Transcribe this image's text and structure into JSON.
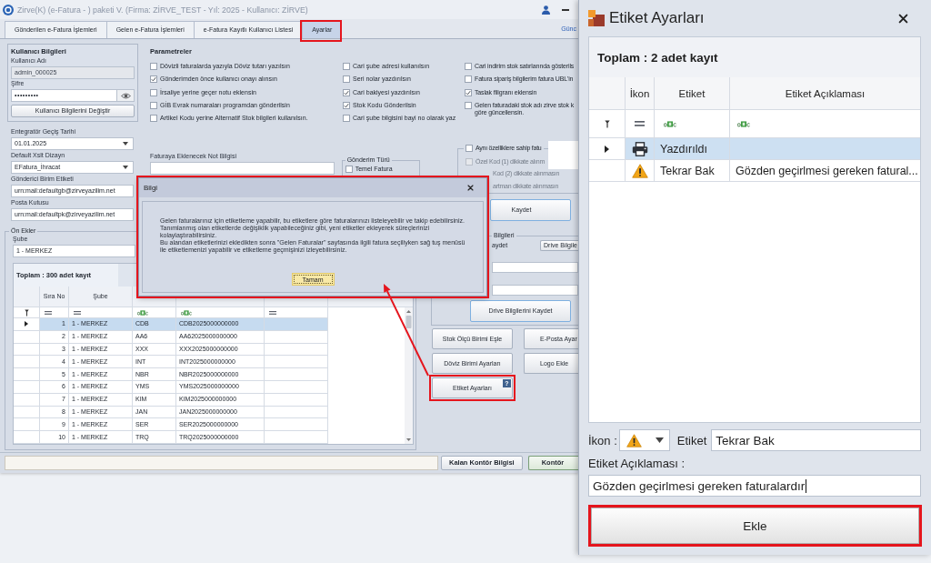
{
  "main_window": {
    "title": "Zirve(K) (e-Fatura - ) paketi V. (Firma: ZİRVE_TEST - Yıl: 2025 - Kullanıcı: ZİRVE)",
    "tabs": [
      {
        "label": "Gönderilen e-Fatura İşlemleri",
        "selected": false,
        "highlighted": false
      },
      {
        "label": "Gelen e-Fatura İşlemleri",
        "selected": false,
        "highlighted": false
      },
      {
        "label": "e-Fatura Kayıtlı Kullanıcı Listesi",
        "selected": false,
        "highlighted": false
      },
      {
        "label": "Ayarlar",
        "selected": true,
        "highlighted": true
      }
    ],
    "update_link": "Günc",
    "user_info": {
      "title": "Kullanıcı Bilgileri",
      "username_label": "Kullanıcı Adı",
      "username": "admin_000025",
      "username_disabled": true,
      "password_label": "Şifre",
      "password": "•••••••••",
      "change_button": "Kullanıcı Bilgilerini Değiştir"
    },
    "settings_fields": [
      {
        "label": "Entegratör Geçiş Tarihi",
        "value": "01.01.2025",
        "kind": "dropdown"
      },
      {
        "label": "Default Xslt Dizayn",
        "value": "EFatura_İhracat",
        "kind": "dropdown"
      },
      {
        "label": "Gönderici Birim Etiketi",
        "value": "urn:mail:defaultgb@zirveyazilim.net",
        "kind": "text"
      },
      {
        "label": "Posta Kutusu",
        "value": "urn:mail:defaultpk@zirveyazilim.net",
        "kind": "text"
      }
    ],
    "prefixes": {
      "title": "Ön Ekler",
      "branch_label": "Şube",
      "branch_value": "1 - MERKEZ",
      "table": {
        "total": "Toplam : 300 adet kayıt",
        "columns": [
          {
            "label": "Sıra No",
            "kind": "equals"
          },
          {
            "label": "Şube",
            "kind": "equals"
          },
          {
            "kind": "text"
          },
          {
            "kind": "text"
          },
          {
            "kind": "equals"
          }
        ],
        "rows": [
          {
            "no": "1",
            "branch": "1 - MERKEZ",
            "column_3": "CDB",
            "column_4": "CDB2025000000000",
            "selected": true
          },
          {
            "no": "2",
            "branch": "1 - MERKEZ",
            "column_3": "AA6",
            "column_4": "AA62025000000000",
            "selected": false
          },
          {
            "no": "3",
            "branch": "1 - MERKEZ",
            "column_3": "XXX",
            "column_4": "XXX2025000000000",
            "selected": false
          },
          {
            "no": "4",
            "branch": "1 - MERKEZ",
            "column_3": "INT",
            "column_4": "INT2025000000000",
            "selected": false
          },
          {
            "no": "5",
            "branch": "1 - MERKEZ",
            "column_3": "NBR",
            "column_4": "NBR2025000000000",
            "selected": false
          },
          {
            "no": "6",
            "branch": "1 - MERKEZ",
            "column_3": "YMS",
            "column_4": "YMS2025000000000",
            "selected": false
          },
          {
            "no": "7",
            "branch": "1 - MERKEZ",
            "column_3": "KIM",
            "column_4": "KIM2025000000000",
            "selected": false
          },
          {
            "no": "8",
            "branch": "1 - MERKEZ",
            "column_3": "JAN",
            "column_4": "JAN2025000000000",
            "selected": false
          },
          {
            "no": "9",
            "branch": "1 - MERKEZ",
            "column_3": "SER",
            "column_4": "SER2025000000000",
            "selected": false
          },
          {
            "no": "10",
            "branch": "1 - MERKEZ",
            "column_3": "TRQ",
            "column_4": "TRQ2025000000000",
            "selected": false
          }
        ]
      }
    },
    "parameters": {
      "title": "Parametreler",
      "columns": [
        {
          "items": [
            {
              "label": "Dövizli faturalarda yazıyla Döviz tutarı yazılsın",
              "checked": false
            },
            {
              "label": "Gönderimden önce kullanıcı onayı alınsın",
              "checked": true
            },
            {
              "label": "İrsaliye yerine geçer notu eklensin",
              "checked": false
            },
            {
              "label": "GİB Evrak numaraları programdan gönderilsin",
              "checked": false
            },
            {
              "label": "Artikel Kodu yerine Alternatif Stok bilgileri kullanılsın.",
              "checked": false
            }
          ]
        },
        {
          "items": [
            {
              "label": "Cari şube adresi kullanılsın",
              "checked": false
            },
            {
              "label": "Seri nolar yazdırılsın",
              "checked": false
            },
            {
              "label": "Cari bakiyesi yazdırılsın",
              "checked": true
            },
            {
              "label": "Stok Kodu Gönderilsin",
              "checked": true
            },
            {
              "label": "Cari şube bilgisini bayi no olarak yaz",
              "checked": false
            }
          ]
        },
        {
          "items": [
            {
              "label": "Cari indirim stok satırlarında gösterils",
              "checked": false
            },
            {
              "label": "Fatura sipariş bilgilerim fatura UBL'in",
              "checked": false
            },
            {
              "label": "Taslak filigranı eklensin",
              "checked": true
            },
            {
              "label": "Gelen faturadaki stok adı zirve stok k\ngöre güncellensin.",
              "checked": false
            }
          ]
        }
      ]
    },
    "note": {
      "label": "Faturaya Eklenecek Not Bilgisi"
    },
    "send_type": {
      "title": "Gönderim Türü",
      "options": [
        {
          "label": "Temel Fatura",
          "checked": false
        }
      ]
    },
    "merge_options": {
      "label": "Aynı özelliklere sahip fatu",
      "checked": false,
      "sub_options": [
        {
          "label": "Özel Kod (1) dikkate alınm",
          "checked": false,
          "disabled": true
        },
        {
          "label": "Kod (2) dikkate alınmasın",
          "disabled": true
        },
        {
          "label": "artman dikkate alınmasın",
          "disabled": true
        }
      ]
    },
    "save_button": "Kaydet",
    "drive": {
      "title": "Bilgileri",
      "option_label": "aydet",
      "info_button": "Drive Bilgile",
      "save_button": "Drive Bilgilerini Kaydet"
    },
    "tool_buttons": [
      {
        "label": "Stok Ölçü Birimi Eşle",
        "highlighted": false
      },
      {
        "label": "E-Posta Ayar",
        "highlighted": false
      },
      {
        "label": "Döviz Birimi Ayarları",
        "highlighted": false
      },
      {
        "label": "Logo Ekle",
        "highlighted": false
      },
      {
        "label": "Etiket Ayarları",
        "help": "?",
        "highlighted": true
      }
    ],
    "status_bar": {
      "buttons": [
        {
          "label": "Kalan Kontör Bilgisi",
          "focused": false
        },
        {
          "label": "Kontör",
          "focused": true
        }
      ]
    }
  },
  "info_dialog": {
    "title": "Bilgi",
    "message": "Gelen faturalarınız için etiketleme yapabilir, bu etiketlere göre faturalarınızı listeleyebilir ve takip edebilirsiniz.\nTanımlanmış olan etiketlerde değişiklik yapabileceğiniz gibi, yeni etiketler ekleyerek süreçlerinizi kolaylaştırabilirsiniz.\nBu alandan etiketlerinizi ekledikten sonra \"Gelen Faturalar\" sayfasında ilgili fatura seçiliyken sağ tuş menüsü ile etiketlemenizi yapabilir ve etiketleme geçmişinizi izleyebilirsiniz.",
    "ok_button": "Tamam",
    "highlighted": true
  },
  "tag_dialog": {
    "title": "Etiket Ayarları",
    "total": "Toplam : 2 adet kayıt",
    "columns": [
      {
        "label": "İkon",
        "kind": "equals"
      },
      {
        "label": "Etiket",
        "kind": "text"
      },
      {
        "label": "Etiket Açıklaması",
        "kind": "text"
      }
    ],
    "rows": [
      {
        "kind": "printer",
        "label": "Yazdırıldı",
        "selected": true
      },
      {
        "kind": "warning",
        "label": "Tekrar Bak",
        "description": "Gözden geçirlmesi gereken fatural...",
        "selected": false
      }
    ],
    "icon_label": "İkon :",
    "icon_choice": {
      "kind": "warning"
    },
    "name_label": "Etiket",
    "name_value": "Tekrar Bak",
    "description_label": "Etiket Açıklaması :",
    "description_value": "Gözden geçirlmesi gereken faturalardır",
    "description_focused": true,
    "add_button": {
      "label": "Ekle",
      "highlighted": true
    }
  },
  "callout_arrow": true
}
